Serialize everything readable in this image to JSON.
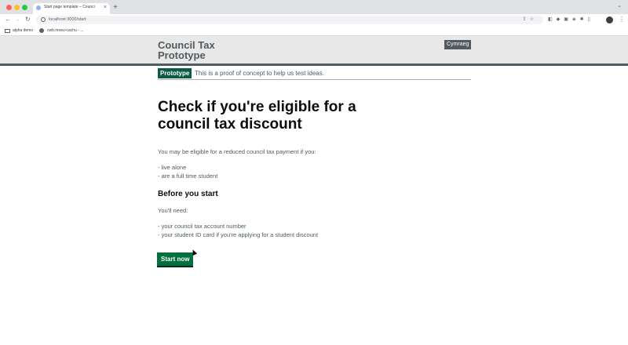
{
  "browser": {
    "tab_title": "Start page template – Counci",
    "tab_close": "×",
    "new_tab": "+",
    "tab_more": "⌄",
    "url": "localhost:3000/start",
    "nav": {
      "back": "←",
      "forward": "→",
      "reload": "↻"
    },
    "bookmarks": [
      "alpha demo",
      "cwb.moeu-cachu - ..."
    ]
  },
  "header": {
    "service_name": "Council Tax Prototype",
    "language_button": "Cymraeg"
  },
  "phase_banner": {
    "tag": "Prototype",
    "text": "This is a proof of concept to help us test ideas."
  },
  "main": {
    "heading": "Check if you're eligible for a council tax discount",
    "intro": "You may be eligible for a reduced council tax payment if you:",
    "eligibility_items": [
      "- live alone",
      "- are a full time student"
    ],
    "subheading": "Before you start",
    "need_intro": "You'll need:",
    "need_items": [
      "- your council tax account number",
      "- your student ID card if you're applying for a student discount"
    ],
    "start_button": "Start now"
  },
  "colors": {
    "header_bg": "#e8e8e8",
    "phase_tag": "#0b5a43",
    "start_button": "#00703c",
    "text_secondary": "#505a5f"
  }
}
